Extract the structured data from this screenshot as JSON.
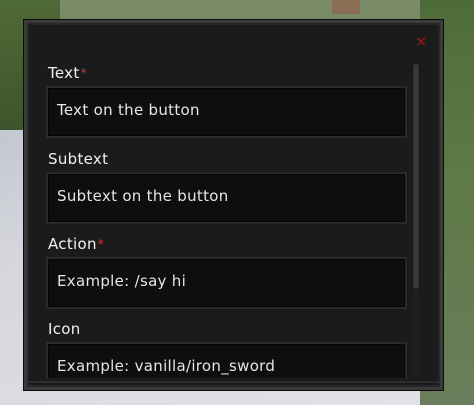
{
  "dialog": {
    "close_icon": "✕",
    "fields": [
      {
        "label": "Text",
        "required": true,
        "value": "Text on the button"
      },
      {
        "label": "Subtext",
        "required": false,
        "value": "Subtext on the button"
      },
      {
        "label": "Action",
        "required": true,
        "value": "Example: /say hi"
      },
      {
        "label": "Icon",
        "required": false,
        "value": "Example: vanilla/iron_sword"
      }
    ],
    "required_marker": "*"
  },
  "colors": {
    "required": "#d23a3a",
    "close": "#8c1b1b"
  }
}
